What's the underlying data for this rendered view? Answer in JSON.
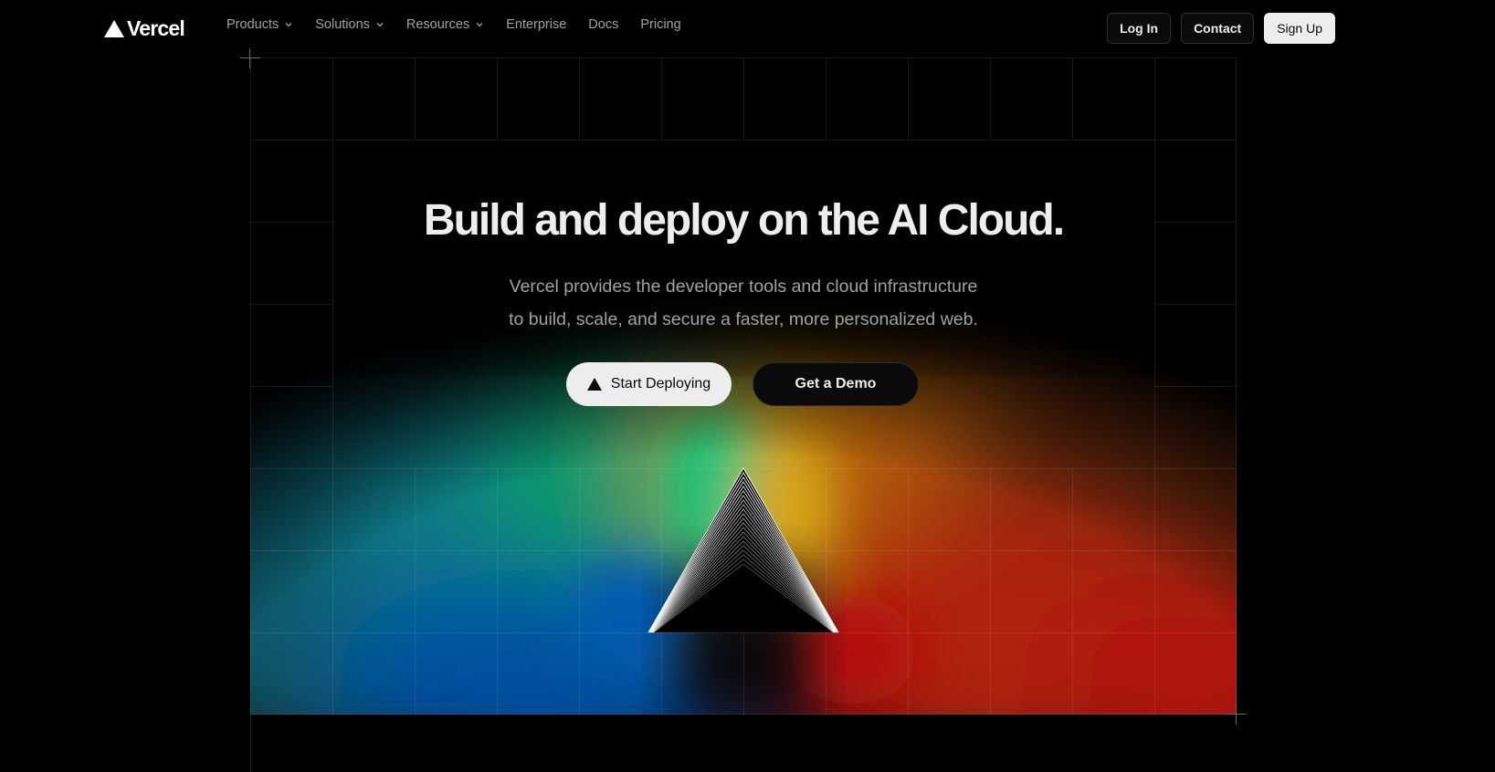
{
  "brand": {
    "name": "Vercel",
    "logo_icon": "triangle-logo-icon"
  },
  "nav": {
    "items": [
      {
        "label": "Products",
        "has_dropdown": true
      },
      {
        "label": "Solutions",
        "has_dropdown": true
      },
      {
        "label": "Resources",
        "has_dropdown": true
      },
      {
        "label": "Enterprise",
        "has_dropdown": false
      },
      {
        "label": "Docs",
        "has_dropdown": false
      },
      {
        "label": "Pricing",
        "has_dropdown": false
      }
    ],
    "login_label": "Log In",
    "contact_label": "Contact",
    "signup_label": "Sign Up"
  },
  "hero": {
    "title": "Build and deploy on the AI Cloud.",
    "subtitle_line1": "Vercel provides the developer tools and cloud infrastructure",
    "subtitle_line2": "to build, scale, and secure a faster, more personalized web.",
    "primary_cta": "Start Deploying",
    "secondary_cta": "Get a Demo"
  },
  "colors": {
    "background": "#000000",
    "text": "#ededed",
    "muted": "#a1a1a1",
    "glow_green": "#0bb26f",
    "glow_yellow": "#d6a412",
    "glow_blue": "#0456a8",
    "glow_red": "#b3120a"
  }
}
